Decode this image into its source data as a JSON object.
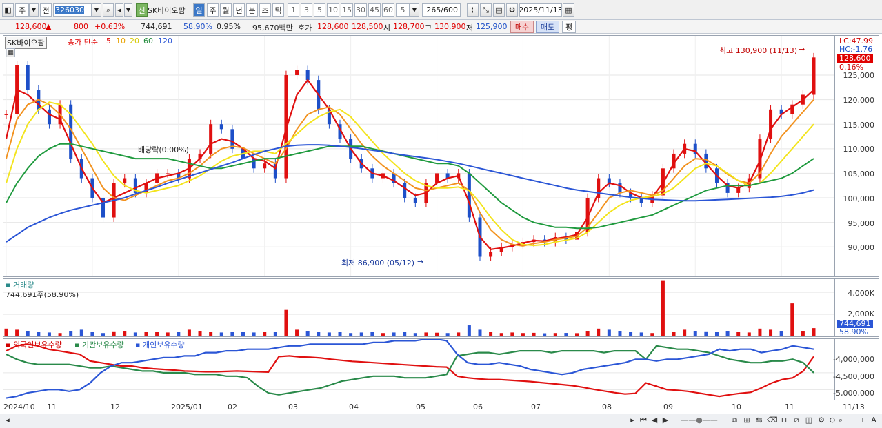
{
  "toolbar": {
    "period_button": "주",
    "prev_label": "전",
    "code": "326030",
    "sin_badge": "신",
    "stock_name": "SK바이오팜",
    "periods": [
      "일",
      "주",
      "월",
      "년",
      "분",
      "초",
      "틱"
    ],
    "minutes": [
      "1",
      "3",
      "5",
      "10",
      "15",
      "30",
      "45",
      "60"
    ],
    "minute_value": "5",
    "count": "265",
    "count_max": "/600",
    "date": "2025/11/13"
  },
  "infobar": {
    "price": "128,600",
    "change": "800",
    "change_pct": "+0.63%",
    "volume": "744,691",
    "volume_ratio": "58.90%",
    "turnover": "0.95%",
    "amount": "95,670백만",
    "quote_label": "호가",
    "ask": "128,600",
    "bid": "128,500",
    "open_label": "시",
    "open": "128,700",
    "high_label": "고",
    "high": "130,900",
    "low_label": "저",
    "low": "125,900",
    "buy_button": "매수",
    "sell_button": "매도",
    "avg_button": "평"
  },
  "price_panel": {
    "title": "SK바이오팜",
    "ma_label": "종가 단순",
    "ma_periods": [
      "5",
      "10",
      "20",
      "60",
      "120"
    ],
    "high_note": "최고 130,900 (11/13)",
    "low_note": "최저 86,900 (05/12)",
    "dividend_note": "배당락(0.00%)",
    "lc": "LC:47.99",
    "hc": "HC:-1.76",
    "price_tag": "128,600",
    "pct_tag": "0.16%"
  },
  "volume_panel": {
    "title": "거래량",
    "value": "744,691주(58.90%)",
    "tag_value": "744,691",
    "tag_pct": "58.90%"
  },
  "holding_panel": {
    "series": [
      "외국인보유수량",
      "기관보유수량",
      "개인보유수량"
    ]
  },
  "x_labels": [
    "2024/10",
    "11",
    "12",
    "2025/01",
    "02",
    "03",
    "04",
    "05",
    "06",
    "07",
    "08",
    "09",
    "10",
    "11",
    "11/13"
  ],
  "chart_data": [
    {
      "type": "candlestick",
      "title": "SK바이오팜",
      "xlabel": "",
      "ylabel": "",
      "ylim": [
        84000,
        133000
      ],
      "yticks": [
        "125,000",
        "120,000",
        "115,000",
        "110,000",
        "105,000",
        "100,000",
        "95,000",
        "90,000"
      ],
      "series": [
        {
          "name": "SK바이오팜",
          "close": [
            117000,
            127000,
            122000,
            118000,
            115000,
            119000,
            108000,
            104000,
            100000,
            96000,
            103000,
            104000,
            101000,
            103000,
            105000,
            105000,
            104000,
            108000,
            109000,
            115000,
            114000,
            110000,
            108000,
            106000,
            107000,
            104000,
            125000,
            126000,
            124000,
            118000,
            115000,
            112000,
            108000,
            106000,
            104000,
            105000,
            103000,
            100000,
            99000,
            103000,
            105000,
            104000,
            105000,
            96000,
            88000,
            89000,
            90000,
            90500,
            91000,
            91500,
            91000,
            92000,
            91500,
            93000,
            100000,
            104000,
            103000,
            101000,
            100000,
            99000,
            100500,
            106000,
            109000,
            111000,
            109000,
            106000,
            103000,
            101000,
            102000,
            104000,
            112000,
            118000,
            117000,
            119000,
            121000,
            128600
          ]
        },
        {
          "name": "종가 단순 5",
          "values": [
            112000,
            122000,
            121000,
            119000,
            117000,
            116000,
            111000,
            106000,
            102000,
            99000,
            100000,
            101000,
            102000,
            103000,
            104000,
            104500,
            105000,
            106000,
            108000,
            111000,
            112000,
            111500,
            110000,
            108000,
            107500,
            106000,
            114000,
            121000,
            124000,
            121000,
            118000,
            114000,
            110000,
            107000,
            105000,
            104500,
            103500,
            102000,
            100500,
            101000,
            103000,
            104000,
            104500,
            99000,
            92000,
            89500,
            89800,
            90200,
            90800,
            91300,
            91200,
            91700,
            92000,
            92500,
            96000,
            101000,
            103000,
            102500,
            101000,
            100000,
            100200,
            103000,
            107000,
            110000,
            109500,
            107000,
            104500,
            102500,
            102000,
            103000,
            107500,
            114000,
            117000,
            118500,
            120000,
            122000
          ]
        },
        {
          "name": "종가 단순 10",
          "values": [
            108000,
            116000,
            119000,
            120000,
            119000,
            117000,
            114000,
            110000,
            106000,
            102000,
            100000,
            99500,
            100500,
            101500,
            102500,
            103500,
            104000,
            105000,
            106500,
            108500,
            110000,
            110500,
            110200,
            109000,
            108000,
            107000,
            110000,
            114000,
            117000,
            118000,
            118500,
            117000,
            114000,
            111000,
            108500,
            106500,
            105000,
            103500,
            102000,
            101500,
            102000,
            102500,
            103000,
            101500,
            97000,
            93500,
            91500,
            90500,
            90200,
            90700,
            91000,
            91500,
            91800,
            92200,
            94000,
            97000,
            100000,
            101000,
            101500,
            101000,
            100500,
            101500,
            104000,
            106500,
            108000,
            107800,
            106500,
            104800,
            103500,
            103000,
            105000,
            109000,
            112500,
            115000,
            117500,
            120000
          ]
        },
        {
          "name": "종가 단순 20",
          "values": [
            103000,
            110000,
            115000,
            118000,
            119500,
            119000,
            117000,
            114000,
            111000,
            107500,
            104500,
            102500,
            101500,
            101000,
            101500,
            102000,
            102500,
            103500,
            104500,
            106000,
            107500,
            108500,
            109000,
            109500,
            109500,
            109000,
            111000,
            113000,
            115000,
            116500,
            117500,
            118000,
            116500,
            114000,
            111500,
            109000,
            107000,
            105000,
            103500,
            102500,
            102000,
            102000,
            102200,
            101500,
            99000,
            96000,
            93500,
            91500,
            90500,
            90300,
            90500,
            91000,
            91400,
            91800,
            93000,
            95000,
            97000,
            98500,
            99500,
            100000,
            100300,
            100800,
            102000,
            104000,
            106000,
            107000,
            106500,
            105000,
            103500,
            102500,
            103000,
            105000,
            107500,
            110000,
            112500,
            115000
          ]
        },
        {
          "name": "종가 단순 60",
          "values": [
            99000,
            103000,
            106000,
            108500,
            110000,
            111000,
            111000,
            110500,
            110000,
            109500,
            109000,
            108500,
            108000,
            108000,
            108000,
            108000,
            107500,
            107000,
            106500,
            106000,
            106000,
            106500,
            107000,
            107500,
            108000,
            108000,
            108500,
            109000,
            109500,
            110000,
            110500,
            110500,
            110500,
            110500,
            110000,
            109500,
            109000,
            108500,
            108000,
            107500,
            107000,
            107000,
            106500,
            105000,
            103000,
            101000,
            99000,
            97500,
            96000,
            95000,
            94500,
            94000,
            94000,
            93800,
            93800,
            94000,
            94500,
            95000,
            95500,
            96000,
            96500,
            97500,
            98500,
            99500,
            100500,
            101500,
            102000,
            102500,
            102500,
            102500,
            103000,
            103500,
            104000,
            105000,
            106500,
            108000
          ]
        },
        {
          "name": "종가 단순 120",
          "values": [
            91000,
            92500,
            94000,
            95000,
            96000,
            96800,
            97500,
            98000,
            98500,
            99000,
            99500,
            100000,
            100800,
            101500,
            102200,
            103000,
            103700,
            104400,
            105100,
            105800,
            106500,
            107200,
            108000,
            108800,
            109500,
            110000,
            110500,
            110700,
            110800,
            110800,
            110700,
            110500,
            110300,
            110000,
            109700,
            109400,
            109000,
            108700,
            108400,
            108100,
            107800,
            107400,
            107000,
            106500,
            106000,
            105500,
            105000,
            104500,
            104000,
            103500,
            103000,
            102500,
            102000,
            101600,
            101300,
            101000,
            100700,
            100400,
            100100,
            99900,
            99700,
            99600,
            99500,
            99400,
            99400,
            99500,
            99600,
            99700,
            99800,
            99900,
            100000,
            100100,
            100300,
            100600,
            101000,
            101600
          ]
        }
      ]
    },
    {
      "type": "bar",
      "title": "거래량",
      "ylim": [
        0,
        5200000
      ],
      "yticks": [
        "4,000K",
        "2,000K"
      ],
      "values": [
        700000,
        600000,
        500000,
        400000,
        350000,
        300000,
        500000,
        600000,
        400000,
        300000,
        450000,
        500000,
        350000,
        400000,
        380000,
        350000,
        420000,
        600000,
        500000,
        400000,
        350000,
        380000,
        420000,
        350000,
        380000,
        400000,
        2400000,
        600000,
        500000,
        400000,
        350000,
        380000,
        300000,
        350000,
        400000,
        300000,
        350000,
        400000,
        300000,
        350000,
        330000,
        300000,
        350000,
        1000000,
        600000,
        400000,
        300000,
        350000,
        300000,
        320000,
        280000,
        300000,
        310000,
        290000,
        500000,
        700000,
        600000,
        500000,
        400000,
        350000,
        300000,
        5100000,
        400000,
        600000,
        500000,
        450000,
        400000,
        500000,
        380000,
        350000,
        700000,
        600000,
        500000,
        3000000,
        500000,
        744691
      ]
    },
    {
      "type": "line",
      "title": "보유수량",
      "ylim": [
        -5300000,
        -3500000
      ],
      "yticks": [
        "-4,000,000",
        "-4,500,000",
        "-5,000,000"
      ],
      "series": [
        {
          "name": "외국인보유수량",
          "color": "#e01010",
          "values": [
            -3850000,
            -3700000,
            -3650000,
            -3700000,
            -3800000,
            -3850000,
            -3900000,
            -3950000,
            -4150000,
            -4200000,
            -4250000,
            -4300000,
            -4300000,
            -4350000,
            -4380000,
            -4400000,
            -4420000,
            -4450000,
            -4460000,
            -4470000,
            -4470000,
            -4460000,
            -4450000,
            -4460000,
            -4470000,
            -4480000,
            -4020000,
            -4000000,
            -4030000,
            -4040000,
            -4060000,
            -4100000,
            -4130000,
            -4160000,
            -4180000,
            -4200000,
            -4220000,
            -4240000,
            -4260000,
            -4280000,
            -4300000,
            -4320000,
            -4330000,
            -4600000,
            -4650000,
            -4680000,
            -4700000,
            -4700000,
            -4720000,
            -4740000,
            -4760000,
            -4790000,
            -4820000,
            -4850000,
            -4880000,
            -4930000,
            -4990000,
            -5040000,
            -5090000,
            -5130000,
            -5110000,
            -4800000,
            -4900000,
            -5000000,
            -5020000,
            -5050000,
            -5100000,
            -5150000,
            -5200000,
            -5150000,
            -5110000,
            -5080000,
            -4950000,
            -4800000,
            -4700000,
            -4650000,
            -4450000,
            -4020000
          ]
        },
        {
          "name": "기관보유수량",
          "color": "#2a8a4a",
          "values": [
            -3950000,
            -4100000,
            -4200000,
            -4250000,
            -4250000,
            -4250000,
            -4250000,
            -4300000,
            -4350000,
            -4350000,
            -4300000,
            -4350000,
            -4400000,
            -4450000,
            -4450000,
            -4500000,
            -4500000,
            -4500000,
            -4550000,
            -4550000,
            -4550000,
            -4600000,
            -4600000,
            -4650000,
            -4900000,
            -5100000,
            -5150000,
            -5100000,
            -5050000,
            -5000000,
            -4950000,
            -4850000,
            -4750000,
            -4700000,
            -4650000,
            -4600000,
            -4600000,
            -4600000,
            -4650000,
            -4650000,
            -4650000,
            -4600000,
            -4550000,
            -4000000,
            -3950000,
            -3900000,
            -3900000,
            -3950000,
            -3900000,
            -3850000,
            -3850000,
            -3850000,
            -3900000,
            -3850000,
            -3850000,
            -3850000,
            -3850000,
            -3900000,
            -3850000,
            -3850000,
            -3850000,
            -4100000,
            -3700000,
            -3750000,
            -3800000,
            -3800000,
            -3850000,
            -3900000,
            -4000000,
            -4100000,
            -4150000,
            -4200000,
            -4200000,
            -4150000,
            -4150000,
            -4100000,
            -4200000,
            -4500000
          ]
        },
        {
          "name": "개인보유수량",
          "color": "#2b56d6",
          "values": [
            -5250000,
            -5200000,
            -5100000,
            -5050000,
            -5000000,
            -5000000,
            -5050000,
            -5000000,
            -4800000,
            -4500000,
            -4300000,
            -4200000,
            -4200000,
            -4150000,
            -4100000,
            -4050000,
            -4050000,
            -4000000,
            -4000000,
            -3900000,
            -3900000,
            -3850000,
            -3850000,
            -3800000,
            -3800000,
            -3800000,
            -3750000,
            -3700000,
            -3700000,
            -3650000,
            -3650000,
            -3650000,
            -3650000,
            -3650000,
            -3650000,
            -3600000,
            -3600000,
            -3550000,
            -3550000,
            -3550000,
            -3500000,
            -3500000,
            -3550000,
            -3950000,
            -4200000,
            -4250000,
            -4250000,
            -4200000,
            -4250000,
            -4300000,
            -4400000,
            -4450000,
            -4500000,
            -4550000,
            -4500000,
            -4400000,
            -4350000,
            -4300000,
            -4250000,
            -4200000,
            -4100000,
            -4100000,
            -4150000,
            -4100000,
            -4100000,
            -4050000,
            -4000000,
            -3950000,
            -3800000,
            -3850000,
            -3800000,
            -3800000,
            -3900000,
            -3850000,
            -3800000,
            -3700000,
            -3750000,
            -3800000
          ]
        }
      ]
    }
  ]
}
